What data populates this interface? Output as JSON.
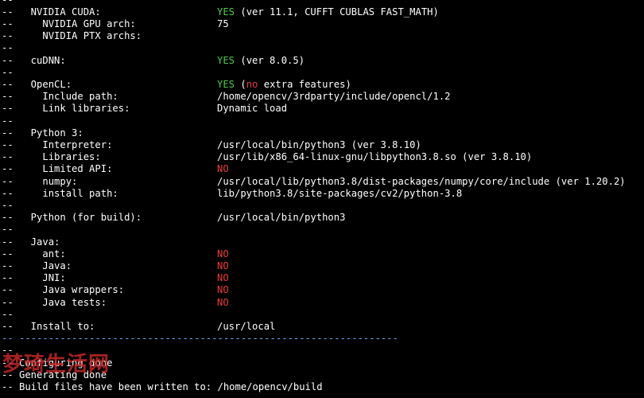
{
  "terminal": {
    "lines": [
      {
        "label": "--",
        "value": ""
      },
      {
        "label": "--   NVIDIA CUDA:",
        "value_parts": [
          {
            "text": "YES",
            "color": "green"
          },
          {
            "text": " (ver 11.1, CUFFT CUBLAS FAST_MATH)",
            "color": ""
          }
        ]
      },
      {
        "label": "--     NVIDIA GPU arch:",
        "value": "75"
      },
      {
        "label": "--     NVIDIA PTX archs:",
        "value": ""
      },
      {
        "label": "--",
        "value": ""
      },
      {
        "label": "--   cuDNN:",
        "value_parts": [
          {
            "text": "YES",
            "color": "green"
          },
          {
            "text": " (ver 8.0.5)",
            "color": ""
          }
        ]
      },
      {
        "label": "--",
        "value": ""
      },
      {
        "label": "--   OpenCL:",
        "value_parts": [
          {
            "text": "YES",
            "color": "green"
          },
          {
            "text": " (",
            "color": ""
          },
          {
            "text": "no",
            "color": "red"
          },
          {
            "text": " extra features)",
            "color": ""
          }
        ]
      },
      {
        "label": "--     Include path:",
        "value": "/home/opencv/3rdparty/include/opencl/1.2"
      },
      {
        "label": "--     Link libraries:",
        "value": "Dynamic load"
      },
      {
        "label": "--",
        "value": ""
      },
      {
        "label": "--   Python 3:",
        "value": ""
      },
      {
        "label": "--     Interpreter:",
        "value": "/usr/local/bin/python3 (ver 3.8.10)"
      },
      {
        "label": "--     Libraries:",
        "value": "/usr/lib/x86_64-linux-gnu/libpython3.8.so (ver 3.8.10)"
      },
      {
        "label": "--     Limited API:",
        "value_parts": [
          {
            "text": "NO",
            "color": "red"
          }
        ]
      },
      {
        "label": "--     numpy:",
        "value": "/usr/local/lib/python3.8/dist-packages/numpy/core/include (ver 1.20.2)"
      },
      {
        "label": "--     install path:",
        "value": "lib/python3.8/site-packages/cv2/python-3.8"
      },
      {
        "label": "--",
        "value": ""
      },
      {
        "label": "--   Python (for build):",
        "value": "/usr/local/bin/python3"
      },
      {
        "label": "--",
        "value": ""
      },
      {
        "label": "--   Java:",
        "value": ""
      },
      {
        "label": "--     ant:",
        "value_parts": [
          {
            "text": "NO",
            "color": "red"
          }
        ]
      },
      {
        "label": "--     Java:",
        "value_parts": [
          {
            "text": "NO",
            "color": "red"
          }
        ]
      },
      {
        "label": "--     JNI:",
        "value_parts": [
          {
            "text": "NO",
            "color": "red"
          }
        ]
      },
      {
        "label": "--     Java wrappers:",
        "value_parts": [
          {
            "text": "NO",
            "color": "red"
          }
        ]
      },
      {
        "label": "--     Java tests:",
        "value_parts": [
          {
            "text": "NO",
            "color": "red"
          }
        ]
      },
      {
        "label": "--",
        "value": ""
      },
      {
        "label": "--   Install to:",
        "value": "/usr/local"
      },
      {
        "label": "-- -----------------------------------------------------------------",
        "value": "",
        "style": "divider"
      },
      {
        "label": "--",
        "value": ""
      },
      {
        "label": "-- Configuring done",
        "value": ""
      },
      {
        "label": "-- Generating done",
        "value": ""
      },
      {
        "label": "-- Build files have been written to: /home/opencv/build",
        "value": ""
      }
    ]
  },
  "watermark": {
    "text": "梦琦生活网"
  },
  "colors": {
    "background": "#000000",
    "text": "#ffffff",
    "yes": "#4ec94e",
    "no": "#ec3b3b",
    "divider": "#7fa0ff"
  }
}
